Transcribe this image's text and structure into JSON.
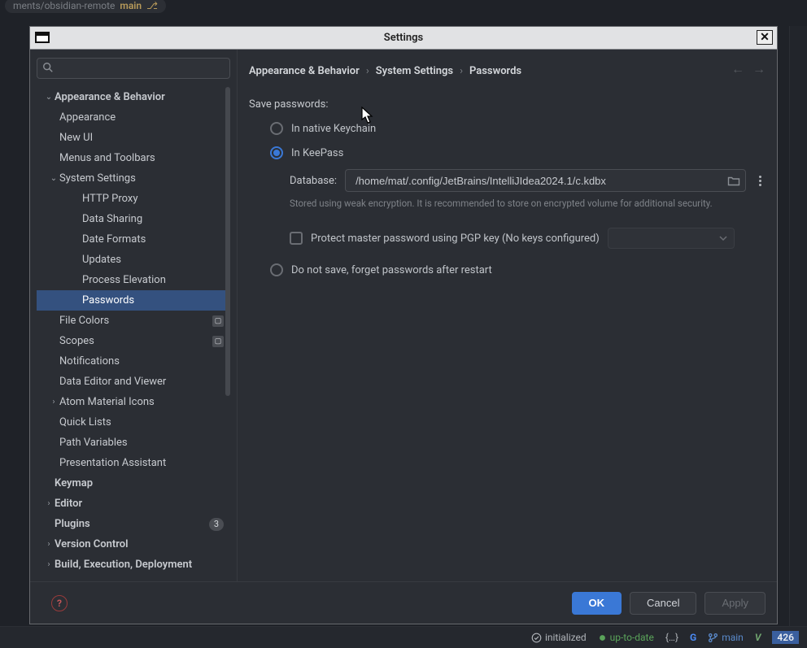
{
  "bg": {
    "path_fragment": "ments/obsidian-remote",
    "branch": "main"
  },
  "statusbar": {
    "initialized": "initialized",
    "up_to_date": "up-to-date",
    "brackets": "{…}",
    "g": "G",
    "branch": "main",
    "vim_mode": "V",
    "end_num": "426"
  },
  "window": {
    "title": "Settings"
  },
  "search": {
    "placeholder": ""
  },
  "breadcrumb": {
    "a": "Appearance & Behavior",
    "b": "System Settings",
    "c": "Passwords"
  },
  "tree": [
    {
      "label": "Appearance & Behavior",
      "indent": 0,
      "chev": "down",
      "bold": true
    },
    {
      "label": "Appearance",
      "indent": 1
    },
    {
      "label": "New UI",
      "indent": 1
    },
    {
      "label": "Menus and Toolbars",
      "indent": 1
    },
    {
      "label": "System Settings",
      "indent": 1,
      "chev": "down"
    },
    {
      "label": "HTTP Proxy",
      "indent": 2
    },
    {
      "label": "Data Sharing",
      "indent": 2
    },
    {
      "label": "Date Formats",
      "indent": 2
    },
    {
      "label": "Updates",
      "indent": 2
    },
    {
      "label": "Process Elevation",
      "indent": 2
    },
    {
      "label": "Passwords",
      "indent": 2,
      "selected": true
    },
    {
      "label": "File Colors",
      "indent": 1,
      "mark": true
    },
    {
      "label": "Scopes",
      "indent": 1,
      "mark": true
    },
    {
      "label": "Notifications",
      "indent": 1
    },
    {
      "label": "Data Editor and Viewer",
      "indent": 1
    },
    {
      "label": "Atom Material Icons",
      "indent": 1,
      "chev": "right"
    },
    {
      "label": "Quick Lists",
      "indent": 1
    },
    {
      "label": "Path Variables",
      "indent": 1
    },
    {
      "label": "Presentation Assistant",
      "indent": 1
    },
    {
      "label": "Keymap",
      "indent": 0,
      "bold": true,
      "noarrow": true
    },
    {
      "label": "Editor",
      "indent": 0,
      "chev": "right",
      "bold": true
    },
    {
      "label": "Plugins",
      "indent": 0,
      "bold": true,
      "noarrow": true,
      "badge": "3"
    },
    {
      "label": "Version Control",
      "indent": 0,
      "chev": "right",
      "bold": true
    },
    {
      "label": "Build, Execution, Deployment",
      "indent": 0,
      "chev": "right",
      "bold": true
    }
  ],
  "main": {
    "section": "Save passwords:",
    "opt_native": "In native Keychain",
    "opt_keepass": "In KeePass",
    "db_label": "Database:",
    "db_value": "/home/mat/.config/JetBrains/IntelliJIdea2024.1/c.kdbx",
    "db_hint": "Stored using weak encryption. It is recommended to store on encrypted volume for additional security.",
    "pgp_label": "Protect master password using PGP key (No keys configured)",
    "opt_forget": "Do not save, forget passwords after restart"
  },
  "footer": {
    "ok": "OK",
    "cancel": "Cancel",
    "apply": "Apply"
  }
}
